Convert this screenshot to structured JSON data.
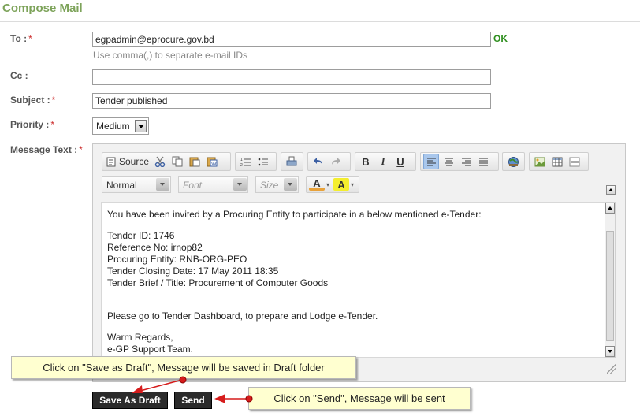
{
  "page": {
    "title": "Compose Mail"
  },
  "form": {
    "to": {
      "label": "To :",
      "required": "*",
      "value": "egpadmin@eprocure.gov.bd",
      "status": "OK",
      "hint": "Use comma(,) to separate e-mail IDs"
    },
    "cc": {
      "label": "Cc :",
      "value": ""
    },
    "subject": {
      "label": "Subject :",
      "required": "*",
      "value": "Tender published"
    },
    "priority": {
      "label": "Priority :",
      "required": "*",
      "value": "Medium"
    },
    "message": {
      "label": "Message Text :",
      "required": "*"
    }
  },
  "editor": {
    "toolbar": {
      "source_label": "Source",
      "format_value": "Normal",
      "font_placeholder": "Font",
      "size_placeholder": "Size",
      "icons": [
        "source-icon",
        "cut-icon",
        "copy-icon",
        "paste-icon",
        "paste-word-icon",
        "numbered-list-icon",
        "bulleted-list-icon",
        "print-icon",
        "undo-icon",
        "redo-icon",
        "bold-icon",
        "italic-icon",
        "underline-icon",
        "align-left-icon",
        "align-center-icon",
        "align-right-icon",
        "justify-icon",
        "link-icon",
        "image-icon",
        "table-icon",
        "horizontal-rule-icon",
        "text-color-icon",
        "background-color-icon"
      ],
      "bold": "B",
      "italic": "I",
      "underline": "U",
      "text_color_glyph": "A",
      "bg_color_glyph": "A"
    },
    "body": {
      "intro": "You have been invited by a Procuring Entity to participate in a below mentioned e-Tender:",
      "tender_id": "Tender ID: 1746",
      "reference": "Reference No: irnop82",
      "procuring_entity": "Procuring Entity: RNB-ORG-PEO",
      "closing_date": "Tender Closing Date: 17 May 2011 18:35",
      "brief": "Tender Brief / Title: Procurement of Computer Goods",
      "instruction": "Please go to Tender Dashboard, to prepare and Lodge e-Tender.",
      "regards": "Warm Regards,",
      "team": "e-GP Support Team."
    }
  },
  "actions": {
    "save_draft": "Save As Draft",
    "send": "Send"
  },
  "callouts": {
    "draft": "Click on \"Save as Draft\", Message will be saved in Draft folder",
    "send": "Click on \"Send\", Message will be sent"
  },
  "colors": {
    "title": "#7da35a",
    "ok": "#2f8f1f",
    "required": "#cc2a2a",
    "button": "#2b2b2b",
    "callout_bg": "#ffffd0",
    "arrow": "#d61c1c"
  }
}
